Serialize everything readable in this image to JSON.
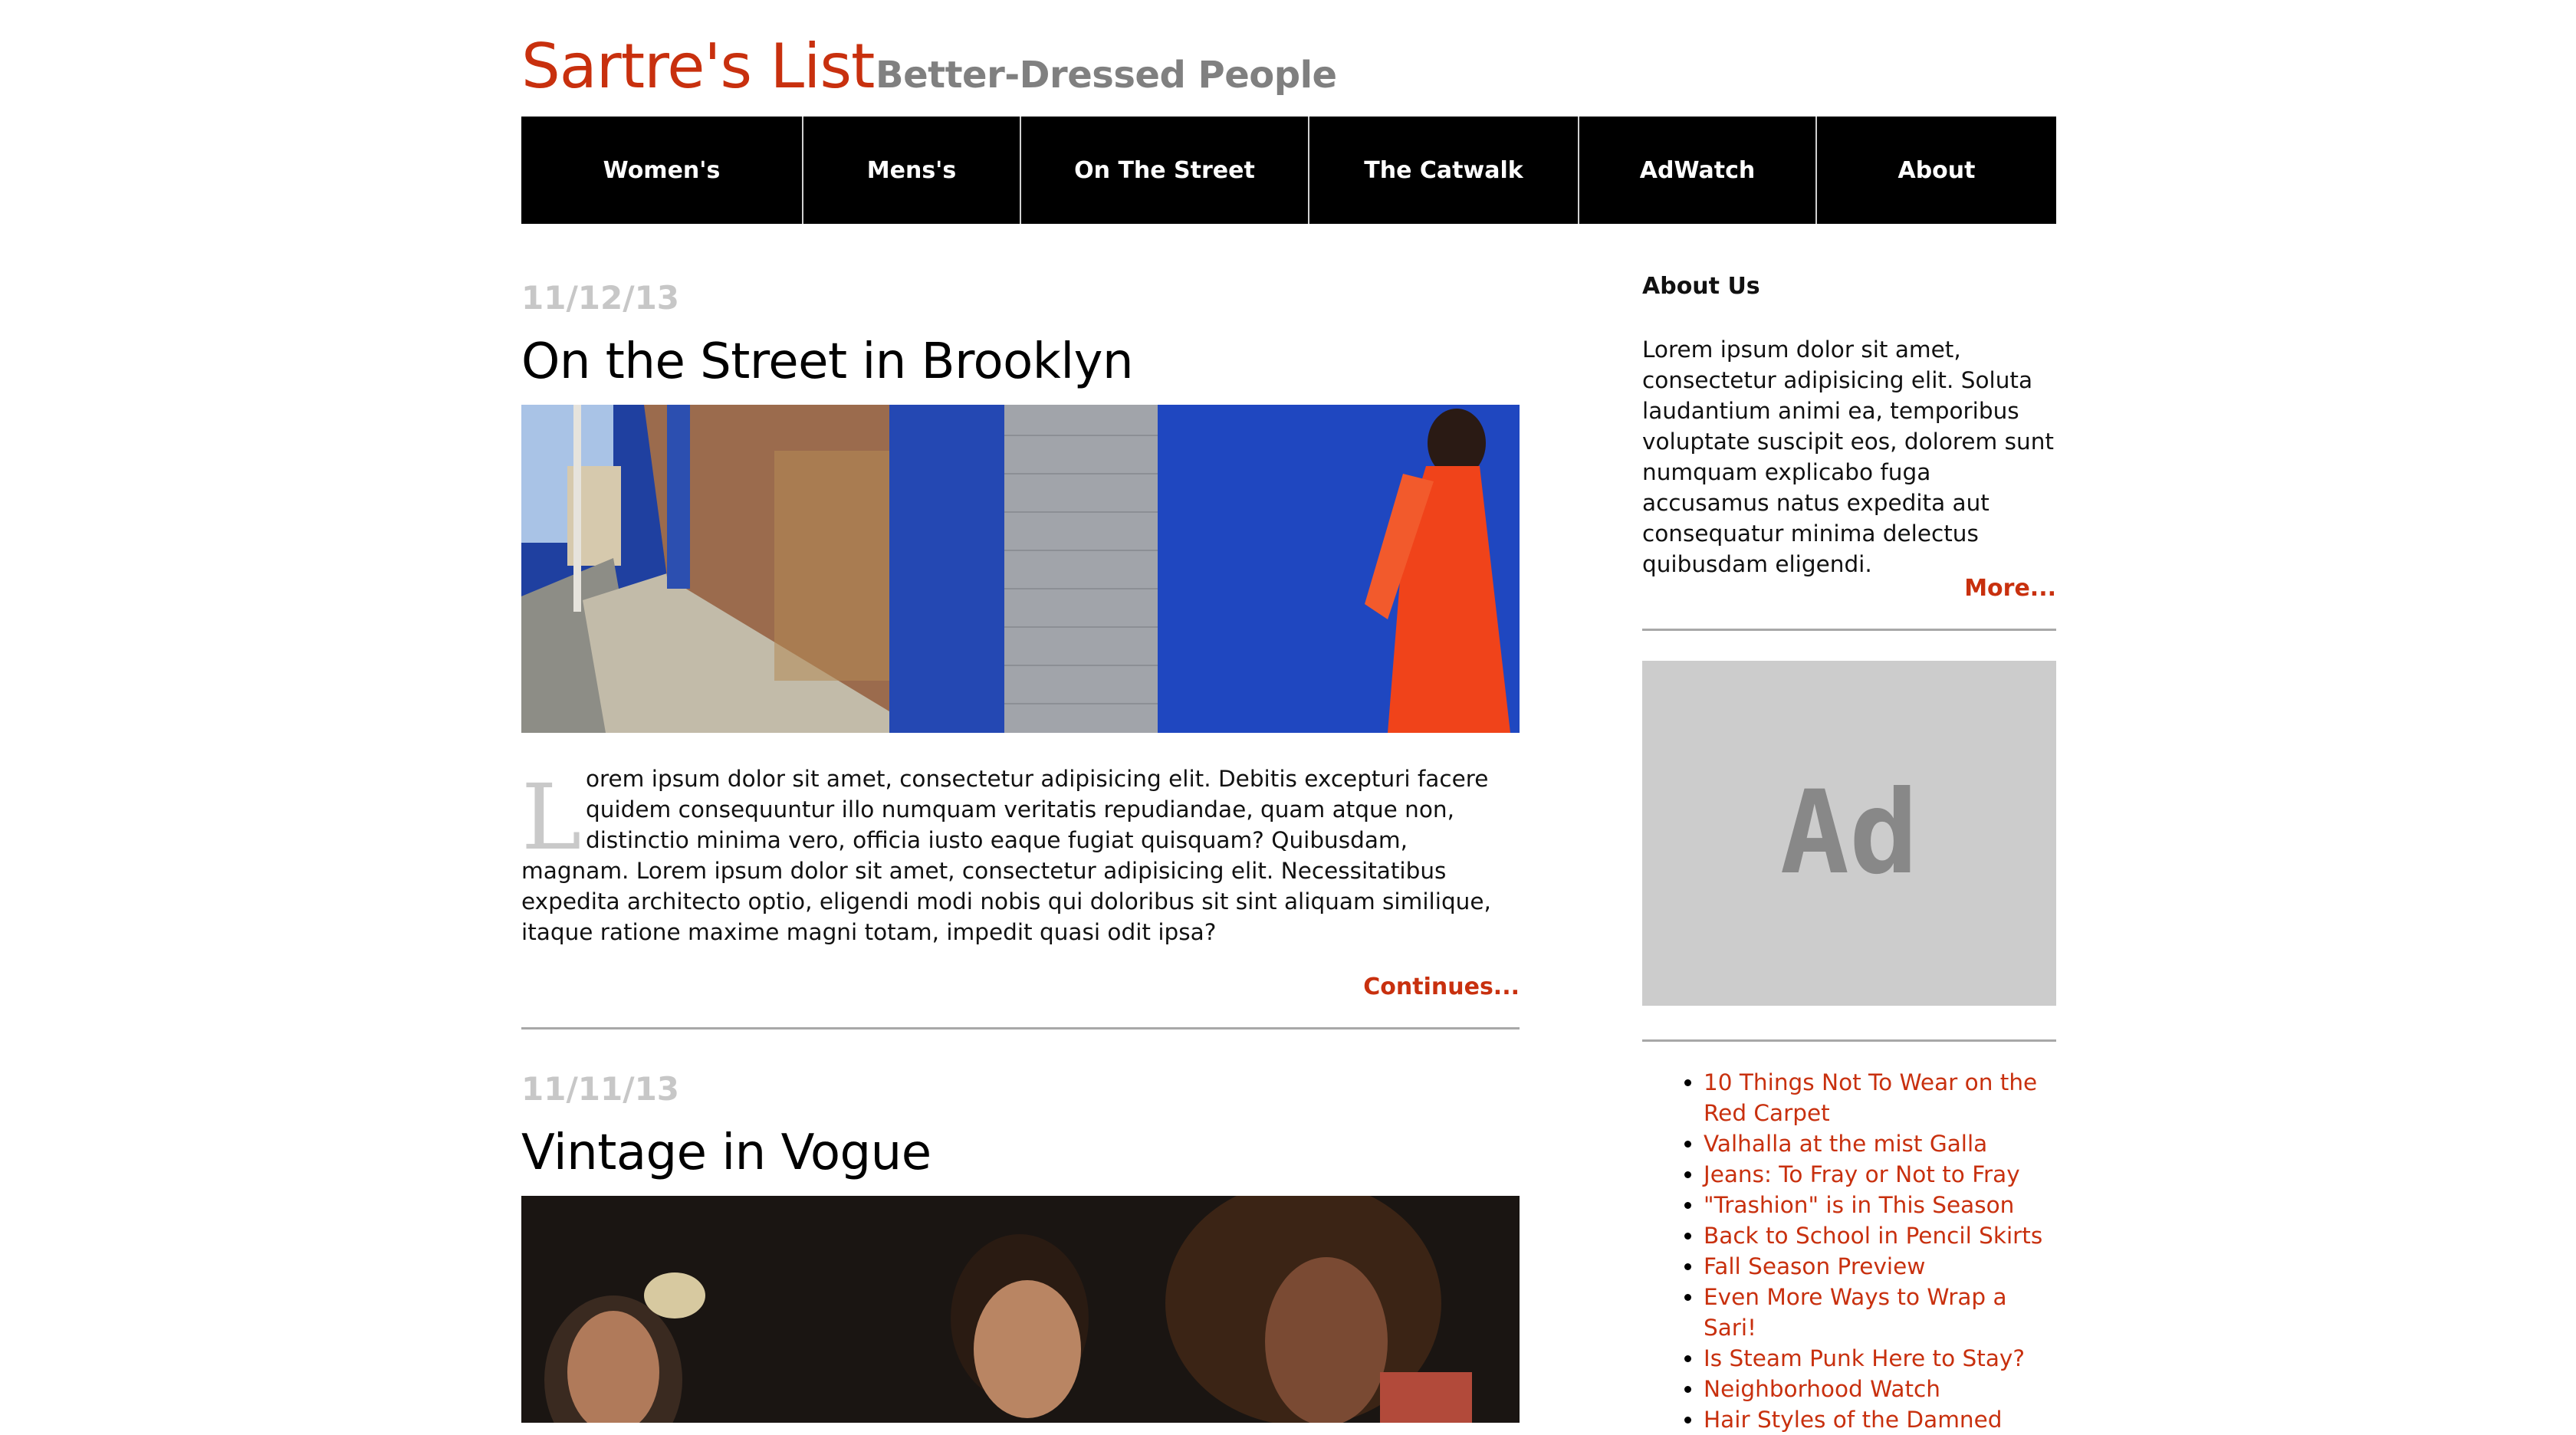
{
  "site": {
    "title": "Sartre's List",
    "tagline": "Better-Dressed People",
    "accent_color": "#c8300e"
  },
  "nav": {
    "items": [
      {
        "label": "Women's"
      },
      {
        "label": "Mens's"
      },
      {
        "label": "On The Street"
      },
      {
        "label": "The Catwalk"
      },
      {
        "label": "AdWatch"
      },
      {
        "label": "About"
      }
    ]
  },
  "posts": [
    {
      "date": "11/12/13",
      "title": "On the Street in Brooklyn",
      "image": "street-photo-woman-orange-dress-blue-wall",
      "dropcap": "L",
      "body": "orem ipsum dolor sit amet, consectetur adipisicing elit. Debitis excepturi facere quidem consequuntur illo numquam veritatis repudiandae, quam atque non, distinctio minima vero, officia iusto eaque fugiat quisquam? Quibusdam, magnam. Lorem ipsum dolor sit amet, consectetur adipisicing elit. Necessitatibus expedita architecto optio, eligendi modi nobis qui doloribus sit sint aliquam similique, itaque ratione maxime magni totam, impedit quasi odit ipsa?",
      "continue_label": "Continues..."
    },
    {
      "date": "11/11/13",
      "title": "Vintage in Vogue",
      "image": "party-photo-three-people"
    }
  ],
  "sidebar": {
    "about_heading": "About Us",
    "about_text": "Lorem ipsum dolor sit amet, consectetur adipisicing elit. Soluta laudantium animi ea, temporibus voluptate suscipit eos, dolorem sunt numquam explicabo fuga accusamus natus expedita aut consequatur minima delectus quibusdam eligendi.",
    "more_label": "More...",
    "ad_label": "Ad",
    "links": [
      "10 Things Not To Wear on the Red Carpet",
      "Valhalla at the mist Galla",
      "Jeans: To Fray or Not to Fray",
      "\"Trashion\" is in This Season",
      "Back to School in Pencil Skirts",
      "Fall Season Preview",
      "Even More Ways to Wrap a Sari!",
      "Is Steam Punk Here to Stay?",
      "Neighborhood Watch",
      "Hair Styles of the Damned"
    ]
  }
}
